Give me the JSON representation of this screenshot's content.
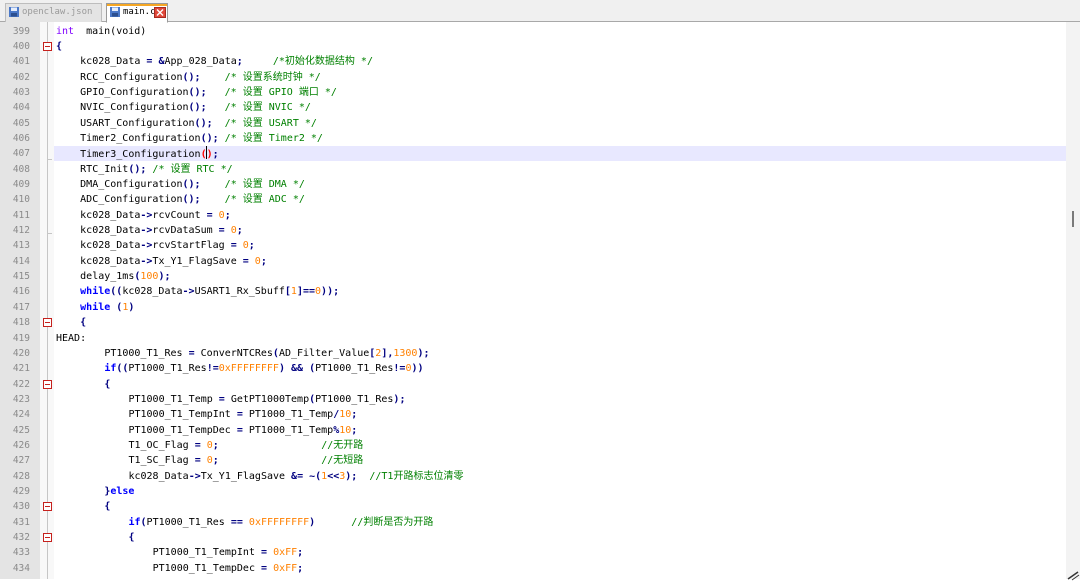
{
  "tabs": [
    {
      "label": "openclaw.json",
      "state": "inactive",
      "icon": "save-disk-icon"
    },
    {
      "label": "main.c",
      "state": "active",
      "icon": "save-disk-icon",
      "close_icon": "close-icon"
    }
  ],
  "colors": {
    "keyword": "#0000ff",
    "type": "#8000ff",
    "number": "#ff8000",
    "comment": "#008000",
    "operator": "#000080",
    "fold_marker": "#c6211d",
    "current_line": "#e8e8ff",
    "tab_accent": "#f5a623"
  },
  "editor": {
    "current_line_number": "407",
    "lines": [
      {
        "n": "399",
        "fold": "",
        "indent": 0,
        "tokens": [
          [
            "ty",
            "int"
          ],
          [
            "",
            "  main(void)"
          ]
        ]
      },
      {
        "n": "400",
        "fold": "open",
        "indent": 0,
        "tokens": [
          [
            "op",
            "{"
          ]
        ]
      },
      {
        "n": "401",
        "fold": "",
        "indent": 4,
        "tokens": [
          [
            "",
            "kc028_Data "
          ],
          [
            "op",
            "="
          ],
          [
            "",
            " "
          ],
          [
            "op",
            "&"
          ],
          [
            "",
            "App_028_Data"
          ],
          [
            "op",
            ";"
          ],
          [
            "",
            "     "
          ],
          [
            "cm",
            "/*初始化数据结构 */"
          ]
        ]
      },
      {
        "n": "402",
        "fold": "",
        "indent": 4,
        "tokens": [
          [
            "",
            "RCC_Configuration"
          ],
          [
            "op",
            "();"
          ],
          [
            "",
            "    "
          ],
          [
            "cm",
            "/* 设置系统时钟 */"
          ]
        ]
      },
      {
        "n": "403",
        "fold": "",
        "indent": 4,
        "tokens": [
          [
            "",
            "GPIO_Configuration"
          ],
          [
            "op",
            "();"
          ],
          [
            "",
            "   "
          ],
          [
            "cm",
            "/* 设置 GPIO 端口 */"
          ]
        ]
      },
      {
        "n": "404",
        "fold": "",
        "indent": 4,
        "tokens": [
          [
            "",
            "NVIC_Configuration"
          ],
          [
            "op",
            "();"
          ],
          [
            "",
            "   "
          ],
          [
            "cm",
            "/* 设置 NVIC */"
          ]
        ]
      },
      {
        "n": "405",
        "fold": "",
        "indent": 4,
        "tokens": [
          [
            "",
            "USART_Configuration"
          ],
          [
            "op",
            "();"
          ],
          [
            "",
            "  "
          ],
          [
            "cm",
            "/* 设置 USART */"
          ]
        ]
      },
      {
        "n": "406",
        "fold": "",
        "indent": 4,
        "tokens": [
          [
            "",
            "Timer2_Configuration"
          ],
          [
            "op",
            "();"
          ],
          [
            "",
            " "
          ],
          [
            "cm",
            "/* 设置 Timer2 */"
          ]
        ]
      },
      {
        "n": "407",
        "fold": "",
        "indent": 4,
        "current": true,
        "tokens": [
          [
            "",
            "Timer3_Configuration"
          ],
          [
            "br",
            "("
          ],
          [
            "caret",
            ""
          ],
          [
            "br",
            ")"
          ],
          [
            "op",
            ";"
          ]
        ]
      },
      {
        "n": "408",
        "fold": "",
        "indent": 4,
        "tokens": [
          [
            "",
            "RTC_Init"
          ],
          [
            "op",
            "();"
          ],
          [
            "",
            " "
          ],
          [
            "cm",
            "/* 设置 RTC */"
          ]
        ]
      },
      {
        "n": "409",
        "fold": "",
        "indent": 4,
        "tokens": [
          [
            "",
            "DMA_Configuration"
          ],
          [
            "op",
            "();"
          ],
          [
            "",
            "    "
          ],
          [
            "cm",
            "/* 设置 DMA */"
          ]
        ]
      },
      {
        "n": "410",
        "fold": "",
        "indent": 4,
        "tokens": [
          [
            "",
            "ADC_Configuration"
          ],
          [
            "op",
            "();"
          ],
          [
            "",
            "    "
          ],
          [
            "cm",
            "/* 设置 ADC */"
          ]
        ]
      },
      {
        "n": "411",
        "fold": "",
        "indent": 4,
        "tokens": [
          [
            "",
            "kc028_Data"
          ],
          [
            "op",
            "->"
          ],
          [
            "",
            "rcvCount "
          ],
          [
            "op",
            "="
          ],
          [
            "",
            " "
          ],
          [
            "num",
            "0"
          ],
          [
            "op",
            ";"
          ]
        ]
      },
      {
        "n": "412",
        "fold": "",
        "indent": 4,
        "tokens": [
          [
            "",
            "kc028_Data"
          ],
          [
            "op",
            "->"
          ],
          [
            "",
            "rcvDataSum "
          ],
          [
            "op",
            "="
          ],
          [
            "",
            " "
          ],
          [
            "num",
            "0"
          ],
          [
            "op",
            ";"
          ]
        ]
      },
      {
        "n": "413",
        "fold": "",
        "indent": 4,
        "tokens": [
          [
            "",
            "kc028_Data"
          ],
          [
            "op",
            "->"
          ],
          [
            "",
            "rcvStartFlag "
          ],
          [
            "op",
            "="
          ],
          [
            "",
            " "
          ],
          [
            "num",
            "0"
          ],
          [
            "op",
            ";"
          ]
        ]
      },
      {
        "n": "414",
        "fold": "",
        "indent": 4,
        "tokens": [
          [
            "",
            "kc028_Data"
          ],
          [
            "op",
            "->"
          ],
          [
            "",
            "Tx_Y1_FlagSave "
          ],
          [
            "op",
            "="
          ],
          [
            "",
            " "
          ],
          [
            "num",
            "0"
          ],
          [
            "op",
            ";"
          ]
        ]
      },
      {
        "n": "415",
        "fold": "",
        "indent": 4,
        "tokens": [
          [
            "",
            "delay_1ms"
          ],
          [
            "op",
            "("
          ],
          [
            "num",
            "100"
          ],
          [
            "op",
            ");"
          ]
        ]
      },
      {
        "n": "416",
        "fold": "",
        "indent": 4,
        "tokens": [
          [
            "kw",
            "while"
          ],
          [
            "op",
            "(("
          ],
          [
            "",
            "kc028_Data"
          ],
          [
            "op",
            "->"
          ],
          [
            "",
            "USART1_Rx_Sbuff"
          ],
          [
            "op",
            "["
          ],
          [
            "num",
            "1"
          ],
          [
            "op",
            "]=="
          ],
          [
            "num",
            "0"
          ],
          [
            "op",
            "));"
          ]
        ]
      },
      {
        "n": "417",
        "fold": "",
        "indent": 4,
        "tokens": [
          [
            "kw",
            "while"
          ],
          [
            "",
            " "
          ],
          [
            "op",
            "("
          ],
          [
            "num",
            "1"
          ],
          [
            "op",
            ")"
          ]
        ]
      },
      {
        "n": "418",
        "fold": "open",
        "indent": 4,
        "tokens": [
          [
            "op",
            "{"
          ]
        ]
      },
      {
        "n": "419",
        "fold": "",
        "indent": 0,
        "tokens": [
          [
            "",
            "HEAD:"
          ]
        ]
      },
      {
        "n": "420",
        "fold": "",
        "indent": 8,
        "tokens": [
          [
            "",
            "PT1000_T1_Res "
          ],
          [
            "op",
            "="
          ],
          [
            "",
            " ConverNTCRes"
          ],
          [
            "op",
            "("
          ],
          [
            "",
            "AD_Filter_Value"
          ],
          [
            "op",
            "["
          ],
          [
            "num",
            "2"
          ],
          [
            "op",
            "],"
          ],
          [
            "num",
            "1300"
          ],
          [
            "op",
            ");"
          ]
        ]
      },
      {
        "n": "421",
        "fold": "",
        "indent": 8,
        "tokens": [
          [
            "kw",
            "if"
          ],
          [
            "op",
            "(("
          ],
          [
            "",
            "PT1000_T1_Res"
          ],
          [
            "op",
            "!="
          ],
          [
            "num",
            "0xFFFFFFFF"
          ],
          [
            "op",
            ")"
          ],
          [
            "",
            " "
          ],
          [
            "op",
            "&&"
          ],
          [
            "",
            " "
          ],
          [
            "op",
            "("
          ],
          [
            "",
            "PT1000_T1_Res"
          ],
          [
            "op",
            "!="
          ],
          [
            "num",
            "0"
          ],
          [
            "op",
            "))"
          ]
        ]
      },
      {
        "n": "422",
        "fold": "open",
        "indent": 8,
        "tokens": [
          [
            "op",
            "{"
          ]
        ]
      },
      {
        "n": "423",
        "fold": "",
        "indent": 12,
        "tokens": [
          [
            "",
            "PT1000_T1_Temp "
          ],
          [
            "op",
            "="
          ],
          [
            "",
            " GetPT1000Temp"
          ],
          [
            "op",
            "("
          ],
          [
            "",
            "PT1000_T1_Res"
          ],
          [
            "op",
            ");"
          ]
        ]
      },
      {
        "n": "424",
        "fold": "",
        "indent": 12,
        "tokens": [
          [
            "",
            "PT1000_T1_TempInt "
          ],
          [
            "op",
            "="
          ],
          [
            "",
            " PT1000_T1_Temp"
          ],
          [
            "op",
            "/"
          ],
          [
            "num",
            "10"
          ],
          [
            "op",
            ";"
          ]
        ]
      },
      {
        "n": "425",
        "fold": "",
        "indent": 12,
        "tokens": [
          [
            "",
            "PT1000_T1_TempDec "
          ],
          [
            "op",
            "="
          ],
          [
            "",
            " PT1000_T1_Temp"
          ],
          [
            "op",
            "%"
          ],
          [
            "num",
            "10"
          ],
          [
            "op",
            ";"
          ]
        ]
      },
      {
        "n": "426",
        "fold": "",
        "indent": 12,
        "tokens": [
          [
            "",
            "T1_OC_Flag "
          ],
          [
            "op",
            "="
          ],
          [
            "",
            " "
          ],
          [
            "num",
            "0"
          ],
          [
            "op",
            ";"
          ],
          [
            "",
            "                 "
          ],
          [
            "cm",
            "//无开路"
          ]
        ]
      },
      {
        "n": "427",
        "fold": "",
        "indent": 12,
        "tokens": [
          [
            "",
            "T1_SC_Flag "
          ],
          [
            "op",
            "="
          ],
          [
            "",
            " "
          ],
          [
            "num",
            "0"
          ],
          [
            "op",
            ";"
          ],
          [
            "",
            "                 "
          ],
          [
            "cm",
            "//无短路"
          ]
        ]
      },
      {
        "n": "428",
        "fold": "",
        "indent": 12,
        "tokens": [
          [
            "",
            "kc028_Data"
          ],
          [
            "op",
            "->"
          ],
          [
            "",
            "Tx_Y1_FlagSave "
          ],
          [
            "op",
            "&="
          ],
          [
            "",
            " "
          ],
          [
            "op",
            "~("
          ],
          [
            "num",
            "1"
          ],
          [
            "op",
            "<<"
          ],
          [
            "num",
            "3"
          ],
          [
            "op",
            ");"
          ],
          [
            "",
            "  "
          ],
          [
            "cm",
            "//T1开路标志位清零"
          ]
        ]
      },
      {
        "n": "429",
        "fold": "",
        "indent": 8,
        "tokens": [
          [
            "op",
            "}"
          ],
          [
            "kw",
            "else"
          ]
        ]
      },
      {
        "n": "430",
        "fold": "open",
        "indent": 8,
        "tokens": [
          [
            "op",
            "{"
          ]
        ]
      },
      {
        "n": "431",
        "fold": "",
        "indent": 12,
        "tokens": [
          [
            "kw",
            "if"
          ],
          [
            "op",
            "("
          ],
          [
            "",
            "PT1000_T1_Res "
          ],
          [
            "op",
            "=="
          ],
          [
            "",
            " "
          ],
          [
            "num",
            "0xFFFFFFFF"
          ],
          [
            "op",
            ")"
          ],
          [
            "",
            "      "
          ],
          [
            "cm",
            "//判断是否为开路"
          ]
        ]
      },
      {
        "n": "432",
        "fold": "open",
        "indent": 12,
        "tokens": [
          [
            "op",
            "{"
          ]
        ]
      },
      {
        "n": "433",
        "fold": "",
        "indent": 16,
        "tokens": [
          [
            "",
            "PT1000_T1_TempInt "
          ],
          [
            "op",
            "="
          ],
          [
            "",
            " "
          ],
          [
            "num",
            "0xFF"
          ],
          [
            "op",
            ";"
          ]
        ]
      },
      {
        "n": "434",
        "fold": "",
        "indent": 16,
        "tokens": [
          [
            "",
            "PT1000_T1_TempDec "
          ],
          [
            "op",
            "="
          ],
          [
            "",
            " "
          ],
          [
            "num",
            "0xFF"
          ],
          [
            "op",
            ";"
          ]
        ]
      }
    ]
  }
}
